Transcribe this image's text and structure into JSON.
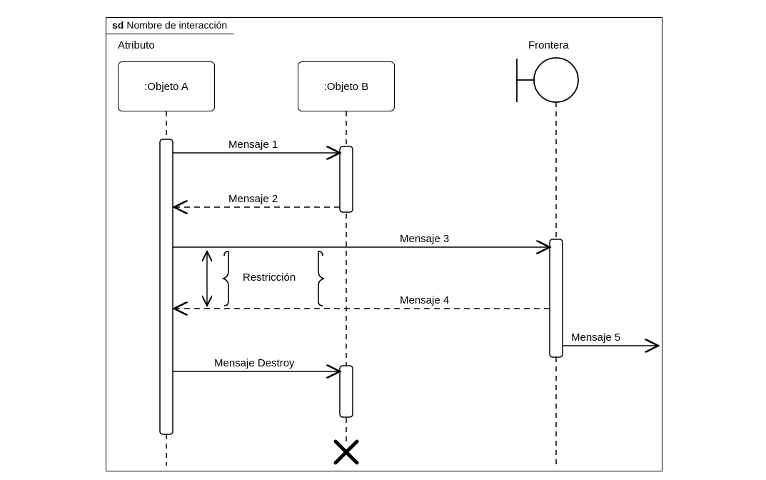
{
  "frame": {
    "tag": "sd",
    "title": "Nombre de interacción"
  },
  "header": {
    "attribute_label": "Atributo",
    "boundary_label": "Frontera"
  },
  "lifelines": {
    "objectA": ":Objeto A",
    "objectB": ":Objeto B"
  },
  "messages": {
    "m1": "Mensaje 1",
    "m2": "Mensaje 2",
    "m3": "Mensaje 3",
    "m4": "Mensaje 4",
    "m5": "Mensaje 5",
    "destroy": "Mensaje Destroy"
  },
  "constraint": "Restricción"
}
